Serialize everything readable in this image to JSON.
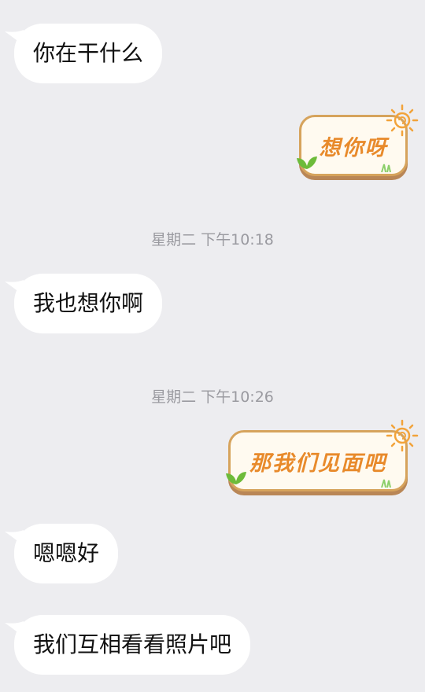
{
  "messages": {
    "m1": "你在干什么",
    "m2_sticker": "想你呀",
    "ts1": "星期二 下午10:18",
    "m3": "我也想你啊",
    "ts2": "星期二 下午10:26",
    "m4_sticker": "那我们见面吧",
    "m5": "嗯嗯好",
    "m6": "我们互相看看照片吧"
  },
  "colors": {
    "background": "#ededf0",
    "bubble": "#ffffff",
    "sticker_text": "#e88a2b",
    "sticker_border": "#d6a35c"
  }
}
